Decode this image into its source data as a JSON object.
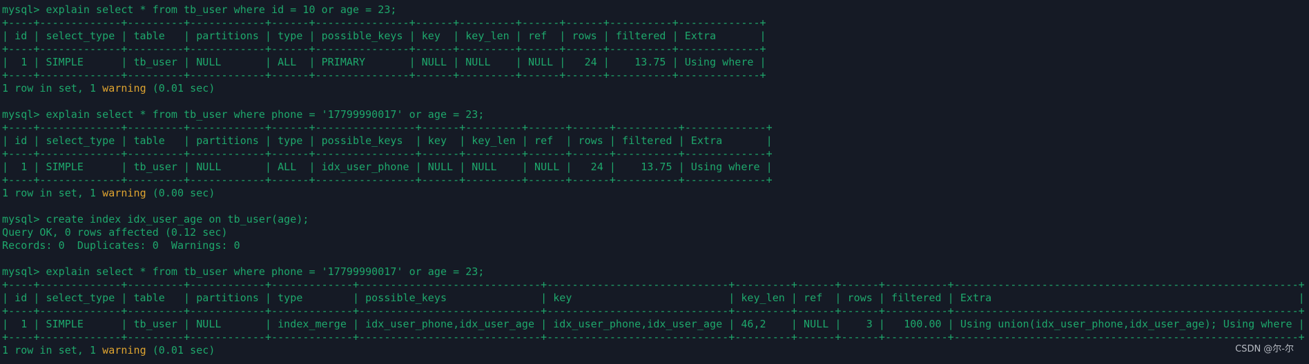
{
  "colors": {
    "background": "#151a25",
    "text": "#1ea86c",
    "warning": "#e0a530"
  },
  "terminal": {
    "lines": [
      {
        "text": "mysql> explain select * from tb_user where id = 10 or age = 23;"
      },
      {
        "text": "+----+-------------+---------+------------+------+---------------+------+---------+------+------+----------+-------------+"
      },
      {
        "text": "| id | select_type | table   | partitions | type | possible_keys | key  | key_len | ref  | rows | filtered | Extra       |"
      },
      {
        "text": "+----+-------------+---------+------------+------+---------------+------+---------+------+------+----------+-------------+"
      },
      {
        "text": "|  1 | SIMPLE      | tb_user | NULL       | ALL  | PRIMARY       | NULL | NULL    | NULL |   24 |    13.75 | Using where |"
      },
      {
        "text": "+----+-------------+---------+------------+------+---------------+------+---------+------+------+----------+-------------+"
      },
      {
        "pre": "1 row in set, 1 ",
        "warn": "warning",
        "post": " (0.01 sec)"
      },
      {
        "text": ""
      },
      {
        "text": "mysql> explain select * from tb_user where phone = '17799990017' or age = 23;"
      },
      {
        "text": "+----+-------------+---------+------------+------+----------------+------+---------+------+------+----------+-------------+"
      },
      {
        "text": "| id | select_type | table   | partitions | type | possible_keys  | key  | key_len | ref  | rows | filtered | Extra       |"
      },
      {
        "text": "+----+-------------+---------+------------+------+----------------+------+---------+------+------+----------+-------------+"
      },
      {
        "text": "|  1 | SIMPLE      | tb_user | NULL       | ALL  | idx_user_phone | NULL | NULL    | NULL |   24 |    13.75 | Using where |"
      },
      {
        "text": "+----+-------------+---------+------------+------+----------------+------+---------+------+------+----------+-------------+"
      },
      {
        "pre": "1 row in set, 1 ",
        "warn": "warning",
        "post": " (0.00 sec)"
      },
      {
        "text": ""
      },
      {
        "text": "mysql> create index idx_user_age on tb_user(age);"
      },
      {
        "text": "Query OK, 0 rows affected (0.12 sec)"
      },
      {
        "text": "Records: 0  Duplicates: 0  Warnings: 0"
      },
      {
        "text": ""
      },
      {
        "text": "mysql> explain select * from tb_user where phone = '17799990017' or age = 23;"
      },
      {
        "text": "+----+-------------+---------+------------+-------------+-----------------------------+-----------------------------+---------+------+------+----------+-------------------------------------------------------+"
      },
      {
        "text": "| id | select_type | table   | partitions | type        | possible_keys               | key                         | key_len | ref  | rows | filtered | Extra                                                 |"
      },
      {
        "text": "+----+-------------+---------+------------+-------------+-----------------------------+-----------------------------+---------+------+------+----------+-------------------------------------------------------+"
      },
      {
        "text": "|  1 | SIMPLE      | tb_user | NULL       | index_merge | idx_user_phone,idx_user_age | idx_user_phone,idx_user_age | 46,2    | NULL |    3 |   100.00 | Using union(idx_user_phone,idx_user_age); Using where |"
      },
      {
        "text": "+----+-------------+---------+------------+-------------+-----------------------------+-----------------------------+---------+------+------+----------+-------------------------------------------------------+"
      },
      {
        "pre": "1 row in set, 1 ",
        "warn": "warning",
        "post": " (0.01 sec)"
      }
    ]
  },
  "watermark": "CSDN @尔-尔"
}
